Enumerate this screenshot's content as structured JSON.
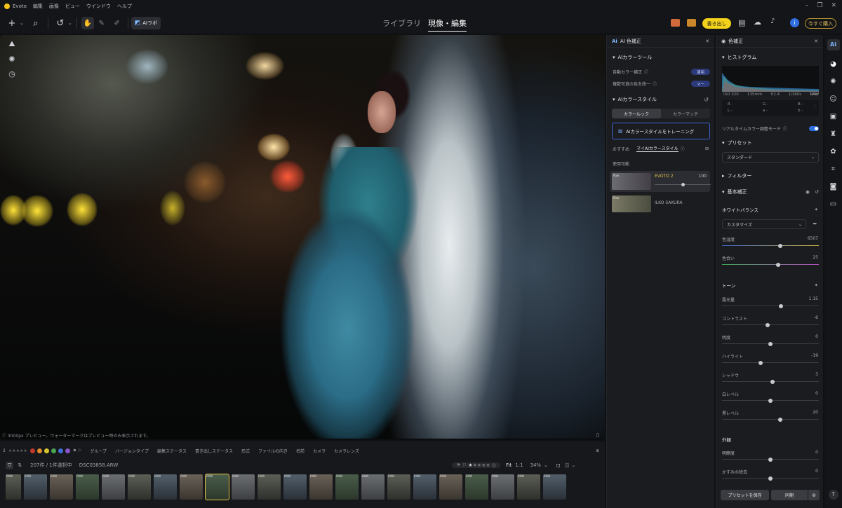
{
  "app": {
    "title": "Evoto",
    "menu": [
      "編集",
      "画像",
      "ビュー",
      "ウインドウ",
      "ヘルプ"
    ]
  },
  "toolbar": {
    "ai_lab": "AIラボ",
    "tab_library": "ライブラリ",
    "tab_develop": "現像・編集",
    "export": "書き出し",
    "buy_now": "今すぐ購入"
  },
  "canvas": {
    "preview_note": "3000px プレビュー。ウォーターマークはプレビュー時のみ表示されます。"
  },
  "filmstrip": {
    "filters": [
      "グループ",
      "バージョンタイプ",
      "編集ステータス",
      "書き出しステータス",
      "形式",
      "ファイルの向き",
      "名前",
      "カメラ",
      "カメラレンズ"
    ],
    "count": "207件 / 1件選択中",
    "filename": "DSC03858.ARW",
    "fit": "Fit",
    "one_to_one": "1:1",
    "zoom": "34%",
    "raw_label": "RAW",
    "star_count": "2",
    "label_colors": [
      "#c0392b",
      "#e08a2c",
      "#d7c431",
      "#4aa552",
      "#3e6fd8",
      "#8a55c9"
    ]
  },
  "ai_panel": {
    "title": "AI 色補正",
    "tools_section": "AIカラーツール",
    "auto_color": "自動カラー補正",
    "auto_color_btn": "適用",
    "unify": "複数写真の色を統一",
    "unify_btn": "マー",
    "style_section": "AIカラースタイル",
    "tab_look": "カラールック",
    "tab_match": "カラーマッチ",
    "train_btn": "AIカラースタイルをトレーニング",
    "sub_recommend": "おすすめ",
    "sub_mine": "マイAIカラースタイル",
    "available": "使用可能",
    "styles": [
      {
        "name": "EVOTO 2",
        "value": "100",
        "tag": "Raw"
      },
      {
        "name": "ILKO SAKURA",
        "value": "",
        "tag": "Raw"
      }
    ]
  },
  "color_panel": {
    "title": "色補正",
    "histogram": "ヒストグラム",
    "exif": [
      "ISO 320",
      "135mm",
      "f/1.4",
      "1/160s",
      "RAW"
    ],
    "rgb": [
      "R -",
      "G -",
      "B -"
    ],
    "lab": [
      "L -",
      "a -",
      "b -"
    ],
    "realtime": "リアルタイムカラー調整モード",
    "preset": "プリセット",
    "preset_value": "スタンダード",
    "filter": "フィルター",
    "basic": "基本補正",
    "wb": "ホワイトバランス",
    "wb_value": "カスタマイズ",
    "wb_sliders": [
      {
        "label": "色温度",
        "value": "6507",
        "pos": 0.6
      },
      {
        "label": "色合い",
        "value": "25",
        "pos": 0.58
      }
    ],
    "tone": "トーン",
    "tone_sliders": [
      {
        "label": "露光量",
        "value": "1.15",
        "pos": 0.61
      },
      {
        "label": "コントラスト",
        "value": "-6",
        "pos": 0.47
      },
      {
        "label": "明度",
        "value": "0",
        "pos": 0.5
      },
      {
        "label": "ハイライト",
        "value": "-19",
        "pos": 0.4
      },
      {
        "label": "シャドウ",
        "value": "3",
        "pos": 0.52
      },
      {
        "label": "白レベル",
        "value": "0",
        "pos": 0.5
      },
      {
        "label": "黒レベル",
        "value": "20",
        "pos": 0.6
      }
    ],
    "presence": "外観",
    "presence_sliders": [
      {
        "label": "明瞭度",
        "value": "0",
        "pos": 0.5
      },
      {
        "label": "かすみの除去",
        "value": "0",
        "pos": 0.5
      }
    ],
    "save_preset": "プリセットを保存",
    "sync": "同期"
  }
}
